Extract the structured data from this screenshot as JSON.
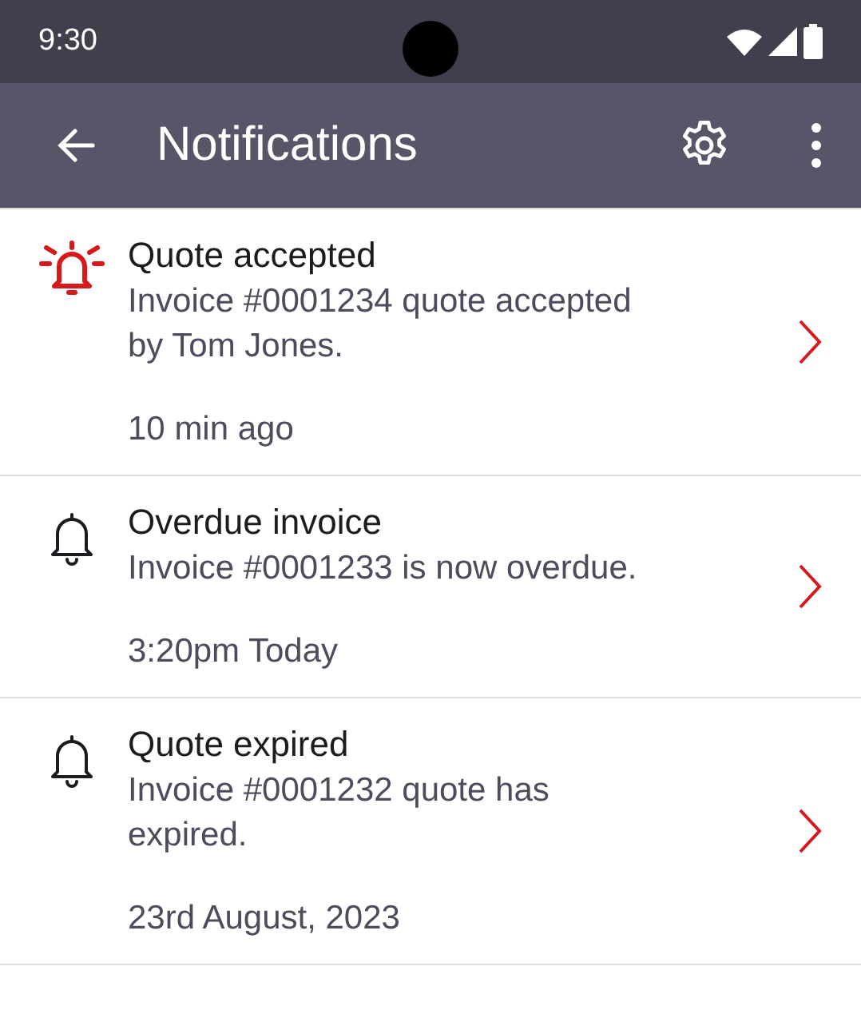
{
  "status_bar": {
    "time": "9:30"
  },
  "app_bar": {
    "title": "Notifications"
  },
  "notifications": [
    {
      "title": "Quote accepted",
      "message": "Invoice #0001234 quote accepted by Tom Jones.",
      "time": "10 min ago",
      "alert": true
    },
    {
      "title": "Overdue invoice",
      "message": "Invoice #0001233 is now overdue.",
      "time": "3:20pm Today",
      "alert": false
    },
    {
      "title": "Quote expired",
      "message": "Invoice #0001232 quote has expired.",
      "time": "23rd August, 2023",
      "alert": false
    }
  ]
}
